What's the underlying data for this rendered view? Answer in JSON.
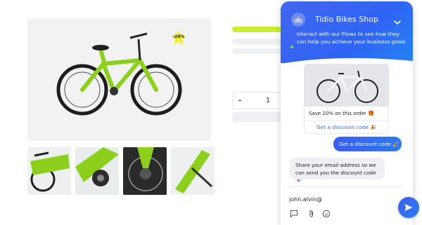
{
  "product": {
    "badge_text": "-20%",
    "quantity": "1",
    "quantity_decrement_label": "-"
  },
  "chat": {
    "shop_name": "Tidio Bikes Shop",
    "intro_text": "Interact with our Flows to see how they can help you achieve your business goals",
    "card": {
      "title": "Save 10% on this order 🎁",
      "link": "Get a discount code 🎉"
    },
    "user_message": "Get a discount code 🎉",
    "bot_message": "Share your email address so we can send you the discount code 💌",
    "composer_value": "john.alvin@",
    "icons": [
      "chat-icon",
      "attachment-icon",
      "emoji-icon",
      "send-icon",
      "chevron-down-icon"
    ]
  },
  "colors": {
    "chat_accent": "#2f63f3",
    "product_green": "#8ccf1d",
    "badge_yellow": "#f2ee3a"
  }
}
